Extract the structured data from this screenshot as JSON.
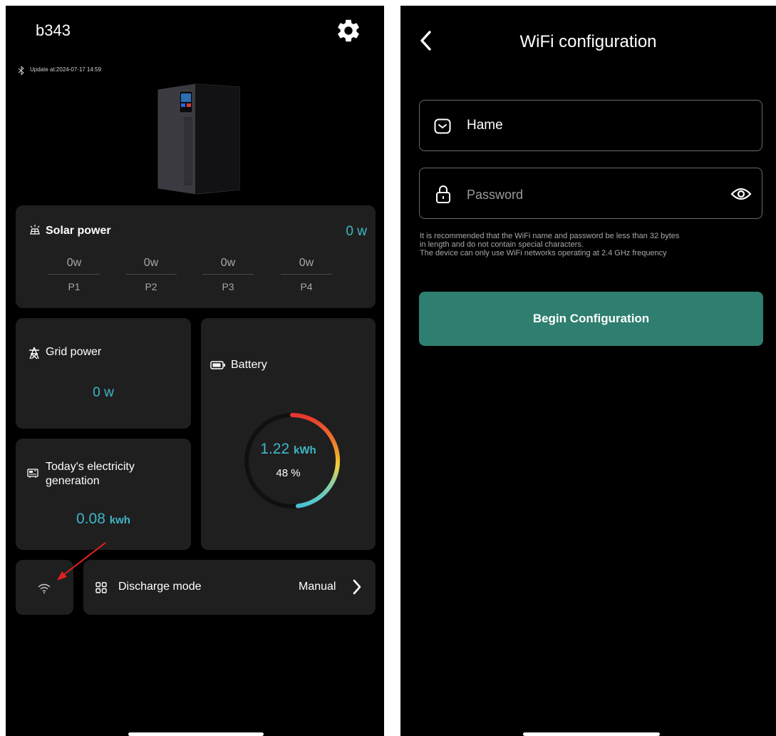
{
  "left_screen": {
    "device_name": "b343",
    "update_text": "Update at:2024-07-17 14:59",
    "solar": {
      "title": "Solar power",
      "value": "0",
      "unit": "w",
      "ports": [
        {
          "value": "0w",
          "label": "P1"
        },
        {
          "value": "0w",
          "label": "P2"
        },
        {
          "value": "0w",
          "label": "P3"
        },
        {
          "value": "0w",
          "label": "P4"
        }
      ]
    },
    "grid": {
      "title": "Grid power",
      "value": "0",
      "unit": "w"
    },
    "battery": {
      "title": "Battery",
      "value": "1.22",
      "unit": "kWh",
      "percent_label": "48 %",
      "percent": 48
    },
    "generation": {
      "title": "Today's electricity generation",
      "value": "0.08",
      "unit": "kwh"
    },
    "discharge": {
      "label": "Discharge mode",
      "value": "Manual"
    }
  },
  "right_screen": {
    "title": "WiFi configuration",
    "name_field": {
      "value": "Hame"
    },
    "password_field": {
      "placeholder": "Password"
    },
    "hint_lines": [
      "It is recommended that the WiFi name and password be less than 32 bytes",
      "in length and do not contain special characters.",
      "The device can only use WiFi networks operating at 2.4 GHz frequency"
    ],
    "begin_button": "Begin Configuration"
  },
  "colors": {
    "accent": "#3fb6c8",
    "card": "#1f1f1f",
    "button": "#2f7f70",
    "annotation_arrow": "#e02020"
  }
}
